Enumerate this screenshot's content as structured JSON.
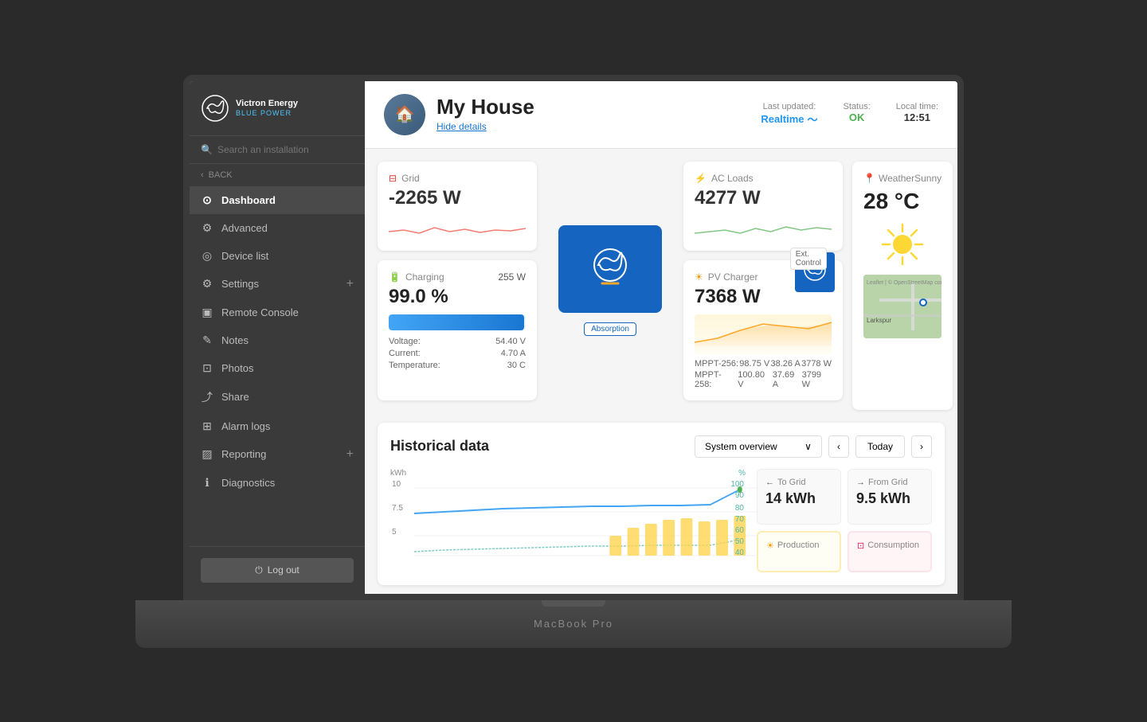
{
  "app": {
    "name": "Victron Energy",
    "tagline": "BLUE POWER"
  },
  "sidebar": {
    "search_placeholder": "Search an installation",
    "back_label": "BACK",
    "nav_items": [
      {
        "id": "dashboard",
        "label": "Dashboard",
        "icon": "⊙",
        "active": true
      },
      {
        "id": "advanced",
        "label": "Advanced",
        "icon": "⚙",
        "active": false
      },
      {
        "id": "device-list",
        "label": "Device list",
        "icon": "◎",
        "active": false
      },
      {
        "id": "settings",
        "label": "Settings",
        "icon": "⚙",
        "active": false,
        "has_plus": true
      },
      {
        "id": "remote-console",
        "label": "Remote Console",
        "icon": "▣",
        "active": false
      },
      {
        "id": "notes",
        "label": "Notes",
        "icon": "✎",
        "active": false
      },
      {
        "id": "photos",
        "label": "Photos",
        "icon": "⊡",
        "active": false
      },
      {
        "id": "share",
        "label": "Share",
        "icon": "⤴",
        "active": false
      },
      {
        "id": "alarm-logs",
        "label": "Alarm logs",
        "icon": "⊞",
        "active": false
      },
      {
        "id": "reporting",
        "label": "Reporting",
        "icon": "▨",
        "active": false,
        "has_plus": true
      },
      {
        "id": "diagnostics",
        "label": "Diagnostics",
        "icon": "ℹ",
        "active": false
      }
    ],
    "logout_label": "Log out"
  },
  "header": {
    "house_name": "My House",
    "hide_details": "Hide details",
    "last_updated_label": "Last updated:",
    "last_updated_value": "Realtime",
    "status_label": "Status:",
    "status_value": "OK",
    "local_time_label": "Local time:",
    "local_time_value": "12:51"
  },
  "grid_card": {
    "title": "Grid",
    "value": "-2265 W",
    "icon": "⊟"
  },
  "inverter": {
    "label": "Absorption"
  },
  "ac_loads": {
    "title": "AC Loads",
    "value": "4277 W"
  },
  "battery": {
    "title": "Charging",
    "power": "255 W",
    "percentage": "99.0 %",
    "voltage_label": "Voltage:",
    "voltage_value": "54.40 V",
    "current_label": "Current:",
    "current_value": "4.70 A",
    "temperature_label": "Temperature:",
    "temperature_value": "30 C"
  },
  "pv_charger": {
    "title": "PV Charger",
    "value": "7368 W",
    "ext_control": "Ext. Control",
    "mppt1_label": "MPPT-256:",
    "mppt1_v": "98.75 V",
    "mppt1_a": "38.26 A",
    "mppt1_w": "3778 W",
    "mppt2_label": "MPPT-258:",
    "mppt2_v": "100.80 V",
    "mppt2_a": "37.69 A",
    "mppt2_w": "3799 W"
  },
  "weather": {
    "title": "Weather",
    "condition": "Sunny",
    "temperature": "28 °C",
    "map_location": "Larkspur"
  },
  "historical": {
    "title": "Historical data",
    "dropdown_value": "System overview",
    "today_label": "Today",
    "chart": {
      "y_label": "kWh",
      "y_right_label": "%",
      "y_values": [
        10,
        7.5,
        5
      ],
      "y_right_values": [
        100,
        90,
        80,
        70,
        60,
        50,
        40
      ],
      "bars": [
        0,
        0,
        0,
        0,
        0.3,
        0.5,
        0.55,
        0.65,
        0.75,
        0.7,
        0.75,
        0.6
      ]
    },
    "stats": [
      {
        "id": "to-grid",
        "label": "→ To Grid",
        "value": "14 kWh",
        "arrow": "←",
        "highlight": false
      },
      {
        "id": "from-grid",
        "label": "← From Grid",
        "value": "9.5 kWh",
        "arrow": "→",
        "highlight": false
      },
      {
        "id": "production",
        "label": "Production",
        "value": "",
        "highlight": true
      },
      {
        "id": "consumption",
        "label": "Consumption",
        "value": "",
        "highlight": false,
        "consumption": true
      }
    ]
  },
  "macbook_label": "MacBook Pro"
}
